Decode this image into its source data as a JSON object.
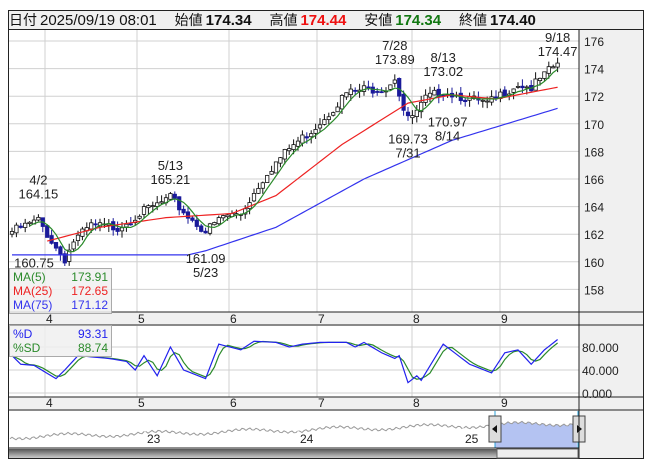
{
  "header": {
    "date_label": "日付",
    "date_value": "2025/09/19 08:01",
    "open_label": "始値",
    "open_value": "174.34",
    "high_label": "高値",
    "high_value": "174.44",
    "low_label": "安値",
    "low_value": "174.34",
    "close_label": "終値",
    "close_value": "174.40",
    "colors": {
      "high": "#ee1111",
      "low": "#117711"
    }
  },
  "chart_data": {
    "type": "candlestick",
    "price_axis": {
      "ticks": [
        "176",
        "174",
        "172",
        "170",
        "168",
        "166",
        "164",
        "162",
        "160",
        "158"
      ],
      "range": [
        157,
        177
      ]
    },
    "month_labels": [
      "4",
      "5",
      "6",
      "7",
      "8",
      "9"
    ],
    "bars": 125,
    "close_anchors": [
      [
        0,
        162.2
      ],
      [
        6,
        163.0
      ],
      [
        10,
        161.0
      ],
      [
        12,
        160.2
      ],
      [
        14,
        161.5
      ],
      [
        18,
        162.6
      ],
      [
        24,
        162.5
      ],
      [
        29,
        163.5
      ],
      [
        36,
        164.6
      ],
      [
        40,
        163.3
      ],
      [
        44,
        162.2
      ],
      [
        48,
        163.3
      ],
      [
        52,
        163.5
      ],
      [
        54,
        164.5
      ],
      [
        58,
        166.5
      ],
      [
        63,
        168.2
      ],
      [
        68,
        169.5
      ],
      [
        72,
        170.8
      ],
      [
        76,
        172.2
      ],
      [
        80,
        172.5
      ],
      [
        85,
        172.6
      ],
      [
        87,
        173.4
      ],
      [
        89,
        171.0
      ],
      [
        90,
        170.3
      ],
      [
        92,
        170.8
      ],
      [
        94,
        171.8
      ],
      [
        98,
        172.4
      ],
      [
        104,
        171.8
      ],
      [
        108,
        171.4
      ],
      [
        112,
        172.3
      ],
      [
        115,
        172.9
      ],
      [
        118,
        172.6
      ],
      [
        121,
        173.5
      ],
      [
        124,
        174.4
      ]
    ],
    "ma25_anchors": [
      [
        8,
        161.5
      ],
      [
        20,
        162.5
      ],
      [
        35,
        163.2
      ],
      [
        50,
        163.5
      ],
      [
        60,
        164.8
      ],
      [
        75,
        168.5
      ],
      [
        90,
        171.5
      ],
      [
        100,
        172.1
      ],
      [
        110,
        171.8
      ],
      [
        124,
        172.65
      ]
    ],
    "ma75_anchors": [
      [
        0,
        160.5
      ],
      [
        40,
        160.5
      ],
      [
        44,
        160.8
      ],
      [
        60,
        162.5
      ],
      [
        80,
        166.0
      ],
      [
        100,
        168.8
      ],
      [
        124,
        171.12
      ]
    ],
    "annotations": [
      {
        "date": "4/2",
        "price": "164.15",
        "bar": 6,
        "pos": "above"
      },
      {
        "date": "",
        "price": "160.75",
        "bar": 5,
        "pos": "below"
      },
      {
        "date": "5/13",
        "price": "165.21",
        "bar": 36,
        "pos": "above"
      },
      {
        "date": "5/23",
        "price": "161.09",
        "bar": 44,
        "pos": "below"
      },
      {
        "date": "7/28",
        "price": "173.89",
        "bar": 87,
        "pos": "above"
      },
      {
        "date": "7/31",
        "price": "169.73",
        "bar": 90,
        "pos": "below"
      },
      {
        "date": "8/13",
        "price": "173.02",
        "bar": 98,
        "pos": "above"
      },
      {
        "date": "8/14",
        "price": "170.97",
        "bar": 99,
        "pos": "below"
      },
      {
        "date": "9/18",
        "price": "174.47",
        "bar": 124,
        "pos": "above"
      }
    ],
    "legend": [
      {
        "label": "MA(5)",
        "value": "173.91",
        "color": "#2a8a2a"
      },
      {
        "label": "MA(25)",
        "value": "172.65",
        "color": "#ee2222"
      },
      {
        "label": "MA(75)",
        "value": "171.12",
        "color": "#3333ee"
      }
    ],
    "stochastic": {
      "ticks": [
        "80.000",
        "40.000",
        "0.000"
      ],
      "legend": [
        {
          "label": "%D",
          "value": "93.31",
          "color": "#2222ee"
        },
        {
          "label": "%SD",
          "value": "88.74",
          "color": "#2a8a2a"
        }
      ],
      "d_anchors": [
        [
          0,
          65
        ],
        [
          2,
          50
        ],
        [
          5,
          48
        ],
        [
          10,
          25
        ],
        [
          12,
          40
        ],
        [
          15,
          65
        ],
        [
          22,
          60
        ],
        [
          26,
          55
        ],
        [
          28,
          40
        ],
        [
          30,
          65
        ],
        [
          33,
          30
        ],
        [
          36,
          80
        ],
        [
          39,
          40
        ],
        [
          44,
          25
        ],
        [
          47,
          85
        ],
        [
          52,
          75
        ],
        [
          55,
          90
        ],
        [
          60,
          88
        ],
        [
          63,
          80
        ],
        [
          66,
          85
        ],
        [
          70,
          88
        ],
        [
          76,
          88
        ],
        [
          78,
          80
        ],
        [
          80,
          88
        ],
        [
          84,
          70
        ],
        [
          87,
          60
        ],
        [
          88,
          65
        ],
        [
          90,
          18
        ],
        [
          92,
          30
        ],
        [
          93,
          22
        ],
        [
          98,
          85
        ],
        [
          104,
          50
        ],
        [
          109,
          35
        ],
        [
          112,
          70
        ],
        [
          115,
          75
        ],
        [
          118,
          50
        ],
        [
          121,
          75
        ],
        [
          124,
          93
        ]
      ]
    },
    "navigator": {
      "year_labels": [
        "23",
        "24",
        "25"
      ]
    }
  }
}
